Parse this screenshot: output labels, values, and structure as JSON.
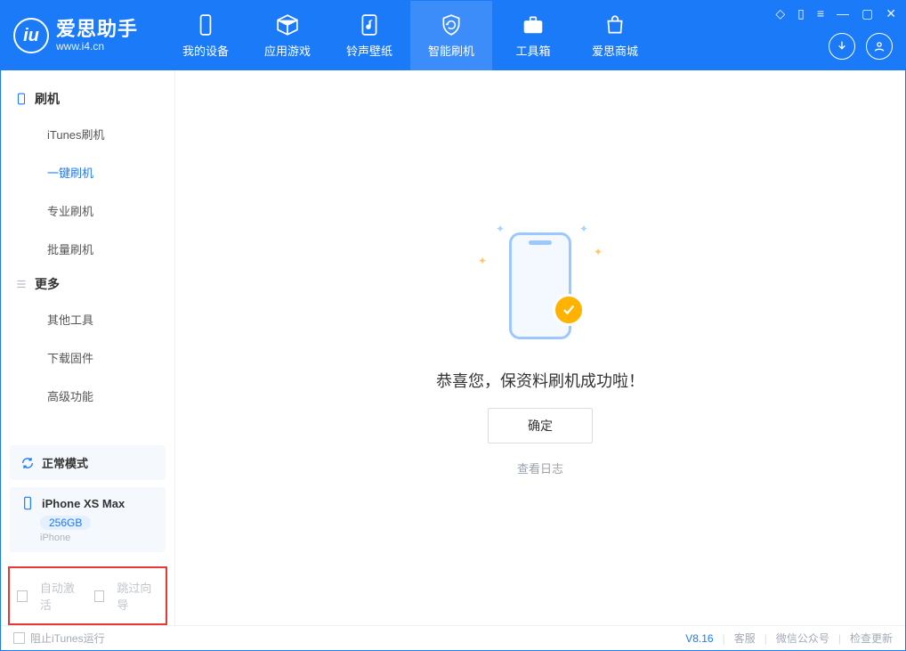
{
  "app": {
    "name": "爱思助手",
    "url": "www.i4.cn"
  },
  "tabs": [
    {
      "label": "我的设备"
    },
    {
      "label": "应用游戏"
    },
    {
      "label": "铃声壁纸"
    },
    {
      "label": "智能刷机"
    },
    {
      "label": "工具箱"
    },
    {
      "label": "爱思商城"
    }
  ],
  "sidebar": {
    "group1": {
      "title": "刷机",
      "items": [
        "iTunes刷机",
        "一键刷机",
        "专业刷机",
        "批量刷机"
      ]
    },
    "group2": {
      "title": "更多",
      "items": [
        "其他工具",
        "下载固件",
        "高级功能"
      ]
    }
  },
  "device": {
    "mode": "正常模式",
    "name": "iPhone XS Max",
    "storage": "256GB",
    "type": "iPhone"
  },
  "checks": {
    "auto_activate": "自动激活",
    "skip_guide": "跳过向导"
  },
  "result": {
    "message": "恭喜您，保资料刷机成功啦！",
    "ok": "确定",
    "log": "查看日志"
  },
  "footer": {
    "block_itunes": "阻止iTunes运行",
    "version": "V8.16",
    "links": [
      "客服",
      "微信公众号",
      "检查更新"
    ]
  }
}
